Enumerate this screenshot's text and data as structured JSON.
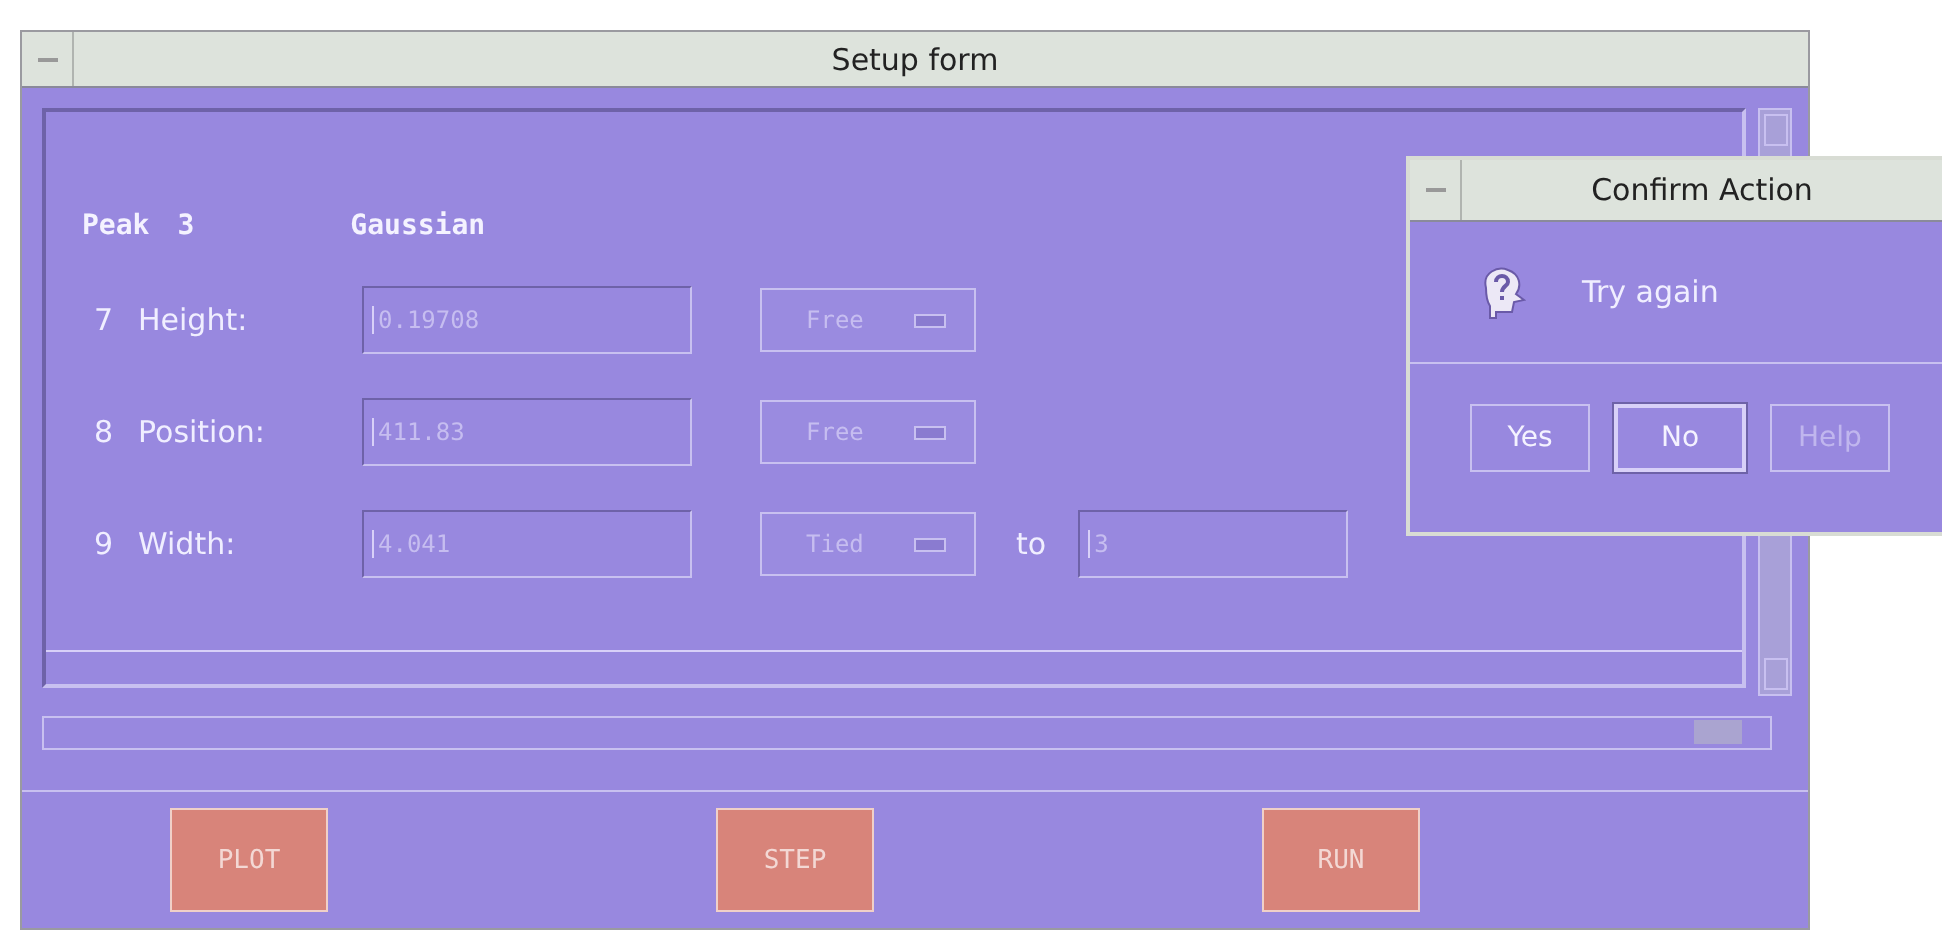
{
  "window": {
    "title": "Setup form"
  },
  "peak": {
    "label": "Peak",
    "number": "3",
    "shape": "Gaussian"
  },
  "parameters": [
    {
      "index": "7",
      "label": "Height:",
      "value": "0.19708",
      "disabled": true,
      "constraint": {
        "label": "Free",
        "disabled": true
      }
    },
    {
      "index": "8",
      "label": "Position:",
      "value": "411.83",
      "disabled": true,
      "constraint": {
        "label": "Free",
        "disabled": true
      }
    },
    {
      "index": "9",
      "label": "Width:",
      "value": "4.041",
      "disabled": true,
      "constraint": {
        "label": "Tied",
        "disabled": true
      },
      "tied_to": {
        "label": "to",
        "value": "3",
        "disabled": true
      }
    }
  ],
  "buttons": [
    {
      "label": "PLOT"
    },
    {
      "label": "STEP"
    },
    {
      "label": "RUN"
    }
  ],
  "dialog": {
    "title": "Confirm Action",
    "message": "Try again",
    "buttons": [
      {
        "label": "Yes",
        "selected": false,
        "disabled": false
      },
      {
        "label": "No",
        "selected": true,
        "disabled": false
      },
      {
        "label": "Help",
        "selected": false,
        "disabled": true
      }
    ]
  }
}
